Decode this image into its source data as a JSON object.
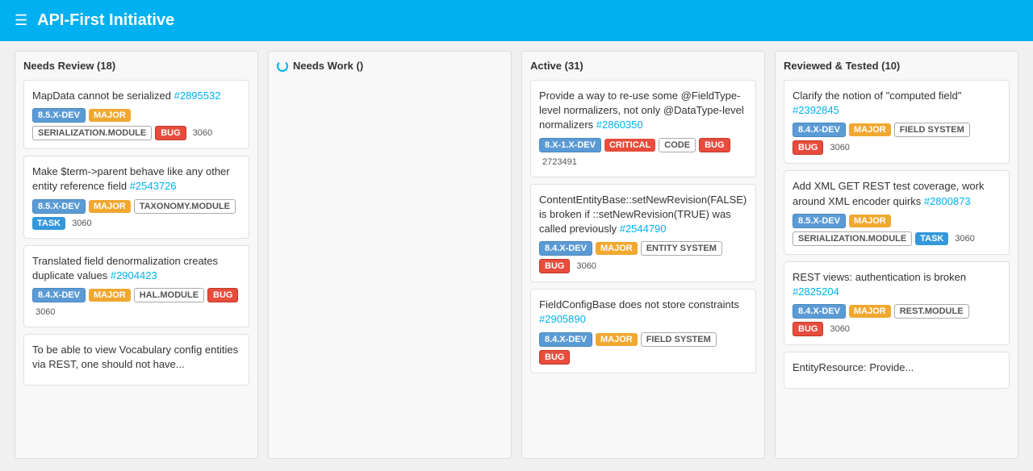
{
  "header": {
    "menu_icon": "☰",
    "title": "API-First Initiative"
  },
  "columns": [
    {
      "id": "needs-review",
      "title": "Needs Review (18)",
      "spinner": false,
      "cards": [
        {
          "title": "MapData cannot be serialized",
          "link_text": "#2895532",
          "link": "#2895532",
          "tags": [
            {
              "label": "8.5.X-DEV",
              "type": "version"
            },
            {
              "label": "MAJOR",
              "type": "major"
            },
            {
              "label": "SERIALIZATION.MODULE",
              "type": "module"
            },
            {
              "label": "BUG",
              "type": "bug"
            },
            {
              "label": "3060",
              "type": "number"
            }
          ]
        },
        {
          "title": "Make $term->parent behave like any other entity reference field",
          "link_text": "#2543726",
          "link": "#2543726",
          "tags": [
            {
              "label": "8.5.X-DEV",
              "type": "version"
            },
            {
              "label": "MAJOR",
              "type": "major"
            },
            {
              "label": "TAXONOMY.MODULE",
              "type": "module"
            },
            {
              "label": "TASK",
              "type": "task"
            },
            {
              "label": "3060",
              "type": "number"
            }
          ]
        },
        {
          "title": "Translated field denormalization creates duplicate values",
          "link_text": "#2904423",
          "link": "#2904423",
          "tags": [
            {
              "label": "8.4.X-DEV",
              "type": "version"
            },
            {
              "label": "MAJOR",
              "type": "major"
            },
            {
              "label": "HAL.MODULE",
              "type": "module"
            },
            {
              "label": "BUG",
              "type": "bug"
            },
            {
              "label": "3060",
              "type": "number"
            }
          ]
        },
        {
          "title": "To be able to view Vocabulary config entities via REST, one should not have...",
          "link_text": "",
          "link": "",
          "tags": []
        }
      ]
    },
    {
      "id": "needs-work",
      "title": "Needs Work ()",
      "spinner": true,
      "cards": []
    },
    {
      "id": "active",
      "title": "Active (31)",
      "spinner": false,
      "cards": [
        {
          "title": "Provide a way to re-use some @FieldType-level normalizers, not only @DataType-level normalizers",
          "link_text": "#2860350",
          "link": "#2860350",
          "tags": [
            {
              "label": "8.X-1.X-DEV",
              "type": "version"
            },
            {
              "label": "CRITICAL",
              "type": "critical"
            },
            {
              "label": "CODE",
              "type": "code"
            },
            {
              "label": "BUG",
              "type": "bug"
            },
            {
              "label": "2723491",
              "type": "number"
            }
          ]
        },
        {
          "title": "ContentEntityBase::setNewRevision(FALSE) is broken if ::setNewRevision(TRUE) was called previously",
          "link_text": "#2544790",
          "link": "#2544790",
          "tags": [
            {
              "label": "8.4.X-DEV",
              "type": "version"
            },
            {
              "label": "MAJOR",
              "type": "major"
            },
            {
              "label": "ENTITY SYSTEM",
              "type": "entity-system"
            },
            {
              "label": "BUG",
              "type": "bug"
            },
            {
              "label": "3060",
              "type": "number"
            }
          ]
        },
        {
          "title": "FieldConfigBase does not store constraints",
          "link_text": "#2905890",
          "link": "#2905890",
          "tags": [
            {
              "label": "8.4.X-DEV",
              "type": "version"
            },
            {
              "label": "MAJOR",
              "type": "major"
            },
            {
              "label": "FIELD SYSTEM",
              "type": "field-system"
            },
            {
              "label": "BUG",
              "type": "bug"
            }
          ]
        }
      ]
    },
    {
      "id": "reviewed-tested",
      "title": "Reviewed & Tested (10)",
      "spinner": false,
      "cards": [
        {
          "title": "Clarify the notion of \"computed field\"",
          "link_text": "#2392845",
          "link": "#2392845",
          "tags": [
            {
              "label": "8.4.X-DEV",
              "type": "version"
            },
            {
              "label": "MAJOR",
              "type": "major"
            },
            {
              "label": "FIELD SYSTEM",
              "type": "field-system"
            },
            {
              "label": "BUG",
              "type": "bug"
            },
            {
              "label": "3060",
              "type": "number"
            }
          ]
        },
        {
          "title": "Add XML GET REST test coverage, work around XML encoder quirks",
          "link_text": "#2800873",
          "link": "#2800873",
          "tags": [
            {
              "label": "8.5.X-DEV",
              "type": "version"
            },
            {
              "label": "MAJOR",
              "type": "major"
            },
            {
              "label": "SERIALIZATION.MODULE",
              "type": "module"
            },
            {
              "label": "TASK",
              "type": "task"
            },
            {
              "label": "3060",
              "type": "number"
            }
          ]
        },
        {
          "title": "REST views: authentication is broken",
          "link_text": "#2825204",
          "link": "#2825204",
          "tags": [
            {
              "label": "8.4.X-DEV",
              "type": "version"
            },
            {
              "label": "MAJOR",
              "type": "major"
            },
            {
              "label": "REST.MODULE",
              "type": "rest-module"
            },
            {
              "label": "BUG",
              "type": "bug"
            },
            {
              "label": "3060",
              "type": "number"
            }
          ]
        },
        {
          "title": "EntityResource: Provide...",
          "link_text": "",
          "link": "",
          "tags": []
        }
      ]
    }
  ]
}
